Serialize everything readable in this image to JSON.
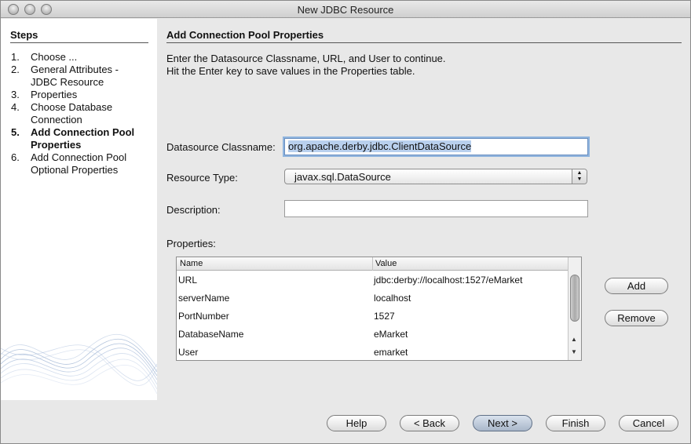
{
  "window": {
    "title": "New JDBC Resource"
  },
  "steps": {
    "heading": "Steps",
    "items": [
      {
        "num": "1.",
        "label": "Choose ..."
      },
      {
        "num": "2.",
        "label": "General Attributes - JDBC Resource"
      },
      {
        "num": "3.",
        "label": "Properties"
      },
      {
        "num": "4.",
        "label": "Choose Database Connection"
      },
      {
        "num": "5.",
        "label": "Add Connection Pool Properties"
      },
      {
        "num": "6.",
        "label": "Add Connection Pool Optional Properties"
      }
    ],
    "current_index": 4
  },
  "content": {
    "heading": "Add Connection Pool Properties",
    "instruction_line1": "Enter the Datasource Classname, URL, and User to continue.",
    "instruction_line2": "Hit the Enter key to save values in the Properties table."
  },
  "form": {
    "classname_label": "Datasource Classname:",
    "classname_value": "org.apache.derby.jdbc.ClientDataSource",
    "resource_type_label": "Resource Type:",
    "resource_type_value": "javax.sql.DataSource",
    "description_label": "Description:",
    "description_value": "",
    "properties_label": "Properties:"
  },
  "properties_table": {
    "columns": [
      "Name",
      "Value"
    ],
    "rows": [
      {
        "name": "URL",
        "value": "jdbc:derby://localhost:1527/eMarket"
      },
      {
        "name": "serverName",
        "value": "localhost"
      },
      {
        "name": "PortNumber",
        "value": "1527"
      },
      {
        "name": "DatabaseName",
        "value": "eMarket"
      },
      {
        "name": "User",
        "value": "emarket"
      }
    ]
  },
  "side_buttons": {
    "add": "Add",
    "remove": "Remove"
  },
  "footer_buttons": {
    "help": "Help",
    "back": "< Back",
    "next": "Next >",
    "finish": "Finish",
    "cancel": "Cancel"
  },
  "icons": {
    "scroll_up": "scroll-up-arrow-icon",
    "scroll_down": "scroll-down-arrow-icon",
    "combo": "combo-arrows-icon"
  }
}
